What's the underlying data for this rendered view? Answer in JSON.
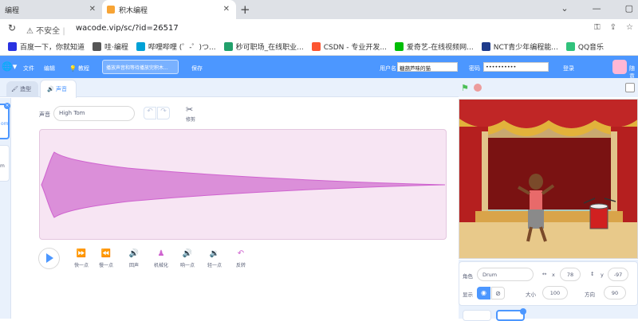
{
  "browser": {
    "tabs": [
      {
        "label": "编程"
      },
      {
        "label": "积木编程"
      }
    ],
    "new_tab": "+",
    "secure_label": "不安全",
    "url": "wacode.vip/sc/?id=26517"
  },
  "bookmarks": [
    {
      "label": "百度一下，你就知道",
      "color": "#2932e1"
    },
    {
      "label": "哇·编程",
      "color": "#555555"
    },
    {
      "label": "哔哩哔哩 (゜-゜)つ...",
      "color": "#00a1d6"
    },
    {
      "label": "秒可职场_在线职业...",
      "color": "#22a06b"
    },
    {
      "label": "CSDN - 专业开发...",
      "color": "#fc5531"
    },
    {
      "label": "爱奇艺-在线视频网...",
      "color": "#00be06"
    },
    {
      "label": "NCT青少年编程能...",
      "color": "#1d3a8a"
    },
    {
      "label": "QQ音乐",
      "color": "#31c27c"
    }
  ],
  "menubar": {
    "file": "文件",
    "edit": "编辑",
    "tutorial": "教程",
    "project_title": "播放声音和等待播放完积木...",
    "save": "保存",
    "username_label": "用户名",
    "username": "糖葫芦味的猫",
    "password_label": "密码",
    "password": "••••••••••",
    "login": "登录",
    "watch": "随意"
  },
  "editor_tabs": {
    "costumes": "造型",
    "sounds": "声音"
  },
  "soundlist": {
    "item_label": "om",
    "item2_label": "m"
  },
  "sound_editor": {
    "sound_label": "声音",
    "sound_name": "High Tom",
    "cut_label": "修剪",
    "effects": [
      {
        "label": "快一点",
        "icon": "faster-icon",
        "glyph": "⏩"
      },
      {
        "label": "慢一点",
        "icon": "slower-icon",
        "glyph": "⏪"
      },
      {
        "label": "回声",
        "icon": "echo-icon",
        "glyph": "🔊"
      },
      {
        "label": "机械化",
        "icon": "robot-icon",
        "glyph": "♟"
      },
      {
        "label": "响一点",
        "icon": "louder-icon",
        "glyph": "🔊"
      },
      {
        "label": "轻一点",
        "icon": "softer-icon",
        "glyph": "🔉"
      },
      {
        "label": "反转",
        "icon": "reverse-icon",
        "glyph": "↶"
      }
    ]
  },
  "sprite_info": {
    "sprite_label": "角色",
    "sprite_name": "Drum",
    "x_label": "x",
    "x": "78",
    "y_label": "y",
    "y": "-97",
    "show_label": "显示",
    "size_label": "大小",
    "size": "100",
    "direction_label": "方向",
    "direction": "90"
  },
  "colors": {
    "accent": "#4c97ff",
    "sound_purple": "#cf63cf",
    "wave_bg": "#f7e5f3"
  }
}
